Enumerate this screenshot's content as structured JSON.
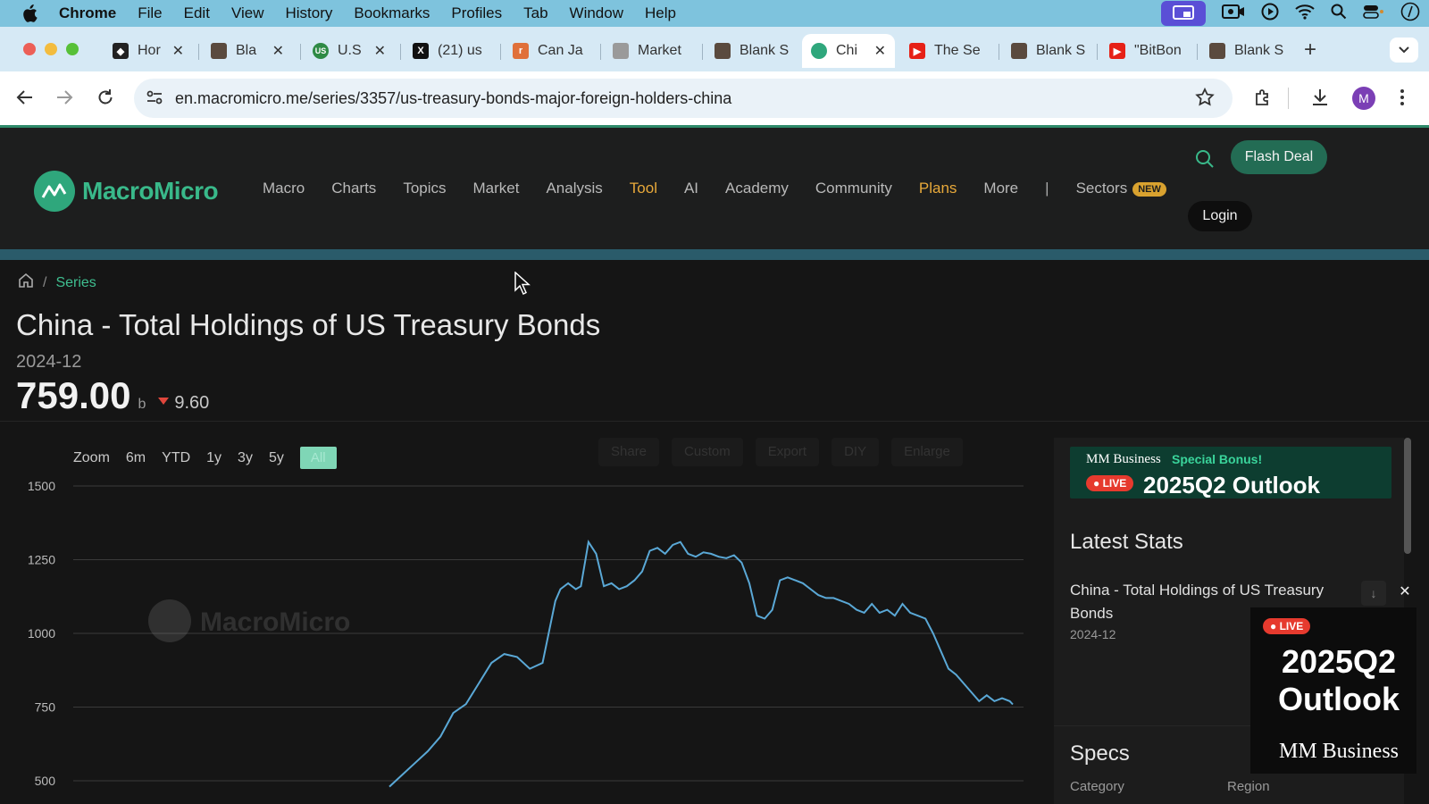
{
  "menubar": {
    "app": "Chrome",
    "items": [
      "File",
      "Edit",
      "View",
      "History",
      "Bookmarks",
      "Profiles",
      "Tab",
      "Window",
      "Help"
    ]
  },
  "tabs": [
    {
      "title": "Hor",
      "icon": "shield-favicon",
      "closable": true
    },
    {
      "title": "Bla",
      "icon": "doc-favicon",
      "closable": true
    },
    {
      "title": "U.S",
      "icon": "us-favicon",
      "closable": true
    },
    {
      "title": "(21) us",
      "icon": "x-favicon",
      "closable": false
    },
    {
      "title": "Can Ja",
      "icon": "r-favicon",
      "closable": false
    },
    {
      "title": "Market",
      "icon": "chart-favicon",
      "closable": false
    },
    {
      "title": "Blank S",
      "icon": "doc-favicon",
      "closable": false
    },
    {
      "title": "Chi",
      "icon": "macromicro-favicon",
      "closable": true,
      "active": true
    },
    {
      "title": "The Se",
      "icon": "youtube-favicon",
      "closable": false
    },
    {
      "title": "Blank S",
      "icon": "doc-favicon",
      "closable": false
    },
    {
      "title": "\"BitBon",
      "icon": "youtube-favicon",
      "closable": false
    },
    {
      "title": "Blank S",
      "icon": "doc-favicon",
      "closable": false
    }
  ],
  "toolbar": {
    "url": "en.macromicro.me/series/3357/us-treasury-bonds-major-foreign-holders-china",
    "avatar_letter": "M"
  },
  "site": {
    "logo_text": "MacroMicro",
    "nav": [
      "Macro",
      "Charts",
      "Topics",
      "Market",
      "Analysis",
      "Tool",
      "AI",
      "Academy",
      "Community",
      "Plans",
      "More"
    ],
    "nav_separator": "|",
    "sectors_label": "Sectors",
    "sectors_badge": "NEW",
    "flash_deal": "Flash Deal",
    "login": "Login",
    "colors": {
      "accent": "#39b98a",
      "highlight": "#e8a93a"
    }
  },
  "page": {
    "breadcrumb_series": "Series",
    "title": "China - Total Holdings of US Treasury Bonds",
    "date": "2024-12",
    "value": "759.00",
    "unit": "b",
    "change": "9.60",
    "change_direction": "down"
  },
  "chart_controls": {
    "zoom_label": "Zoom",
    "ranges": [
      "6m",
      "YTD",
      "1y",
      "3y",
      "5y",
      "All"
    ],
    "selected": "All",
    "tools": [
      "Share",
      "Custom",
      "Export",
      "DIY",
      "Enlarge"
    ]
  },
  "chart_data": {
    "type": "line",
    "title": "",
    "xlabel": "",
    "ylabel": "",
    "y_ticks": [
      500,
      750,
      1000,
      1250,
      1500
    ],
    "ylim": [
      500,
      1500
    ],
    "grid": true,
    "watermark": "MacroMicro",
    "series": [
      {
        "color": "#5aa8d6",
        "x": [
          2000.5,
          2001,
          2001.5,
          2002,
          2002.5,
          2003,
          2003.5,
          2004,
          2004.5,
          2005,
          2005.5,
          2006,
          2006.5,
          2007,
          2007.2,
          2007.5,
          2007.8,
          2008,
          2008.3,
          2008.6,
          2008.9,
          2009.2,
          2009.5,
          2009.8,
          2010.1,
          2010.4,
          2010.7,
          2011,
          2011.3,
          2011.6,
          2011.9,
          2012.2,
          2012.5,
          2012.8,
          2013.1,
          2013.4,
          2013.7,
          2014,
          2014.3,
          2014.6,
          2014.9,
          2015.2,
          2015.5,
          2015.8,
          2016.1,
          2016.4,
          2016.7,
          2017,
          2017.3,
          2017.6,
          2017.9,
          2018.2,
          2018.5,
          2018.8,
          2019.1,
          2019.4,
          2019.7,
          2020,
          2020.3,
          2020.6,
          2020.9,
          2021.2,
          2021.5,
          2021.8,
          2022.1,
          2022.4,
          2022.7,
          2023,
          2023.3,
          2023.6,
          2023.9,
          2024.2,
          2024.5,
          2024.8,
          2024.92
        ],
        "values": [
          480,
          520,
          560,
          600,
          650,
          730,
          760,
          830,
          900,
          930,
          920,
          880,
          900,
          1110,
          1150,
          1170,
          1150,
          1160,
          1310,
          1270,
          1160,
          1170,
          1150,
          1160,
          1180,
          1210,
          1280,
          1290,
          1270,
          1300,
          1310,
          1270,
          1260,
          1275,
          1270,
          1260,
          1255,
          1265,
          1240,
          1170,
          1060,
          1050,
          1080,
          1180,
          1190,
          1180,
          1170,
          1150,
          1130,
          1120,
          1120,
          1110,
          1100,
          1080,
          1070,
          1100,
          1070,
          1080,
          1060,
          1100,
          1070,
          1060,
          1050,
          1000,
          940,
          880,
          860,
          830,
          800,
          770,
          790,
          770,
          780,
          770,
          759
        ]
      }
    ]
  },
  "sidebar": {
    "banner": {
      "brand": "MM Business",
      "bonus": "Special Bonus!",
      "live": "LIVE",
      "headline": "2025Q2 Outlook"
    },
    "latest_stats": "Latest Stats",
    "stat_name": "China - Total Holdings of US Treasury Bonds",
    "stat_date": "2024-12",
    "specs": "Specs",
    "spec_category": "Category",
    "spec_region": "Region"
  },
  "float_ad": {
    "live": "LIVE",
    "headline": "2025Q2 Outlook",
    "brand": "MM Business"
  }
}
